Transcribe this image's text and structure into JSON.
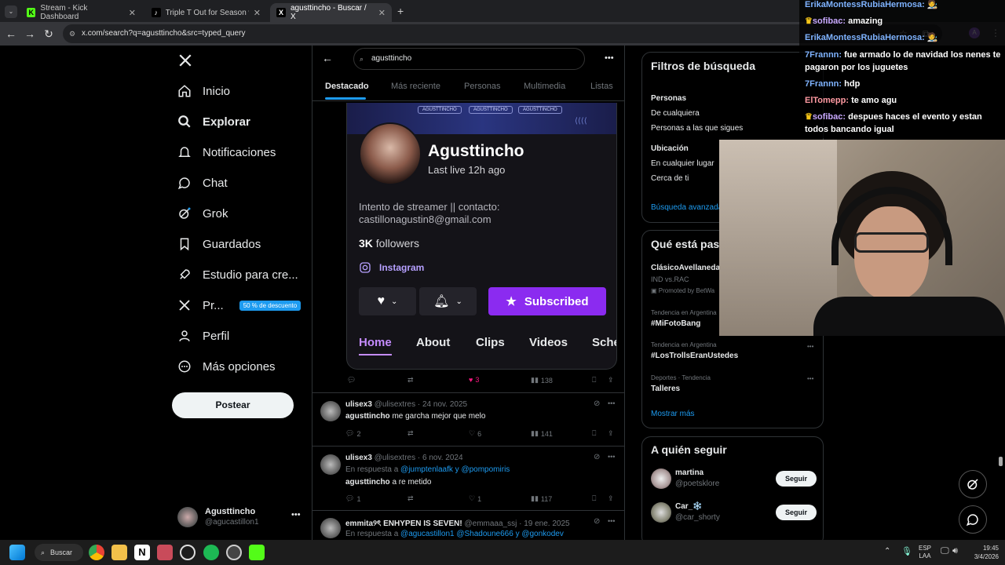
{
  "browser": {
    "tabs": [
      {
        "title": "Stream - Kick Dashboard",
        "favicon": "K"
      },
      {
        "title": "Triple T Out for Season with AC",
        "favicon": "♪"
      },
      {
        "title": "agusttincho - Buscar / X",
        "favicon": "X"
      }
    ],
    "url": "x.com/search?q=agusttincho&src=typed_query"
  },
  "nav": {
    "items": [
      {
        "label": "Inicio",
        "icon": "home-icon"
      },
      {
        "label": "Explorar",
        "icon": "search-icon"
      },
      {
        "label": "Notificaciones",
        "icon": "bell-icon"
      },
      {
        "label": "Chat",
        "icon": "chat-icon"
      },
      {
        "label": "Grok",
        "icon": "grok-icon"
      },
      {
        "label": "Guardados",
        "icon": "bookmark-icon"
      },
      {
        "label": "Estudio para cre...",
        "icon": "rocket-icon"
      },
      {
        "label": "Pr...",
        "icon": "x-logo-icon",
        "badge": "50 % de descuento"
      },
      {
        "label": "Perfil",
        "icon": "person-icon"
      },
      {
        "label": "Más opciones",
        "icon": "more-icon"
      }
    ],
    "post_label": "Postear",
    "account": {
      "name": "Agusttincho",
      "handle": "@agucastillon1"
    }
  },
  "search": {
    "query": "agusttincho",
    "tabs": [
      "Destacado",
      "Más reciente",
      "Personas",
      "Multimedia",
      "Listas"
    ]
  },
  "kick_card": {
    "streamer": "Agusttincho",
    "last_live": "Last live 12h ago",
    "bio_line1": "Intento de streamer || contacto:",
    "bio_line2": "castillonagustin8@gmail.com",
    "followers_count": "3K",
    "followers_label": "followers",
    "instagram": "Instagram",
    "subscribed_label": "Subscribed",
    "tabs": [
      "Home",
      "About",
      "Clips",
      "Videos",
      "Sche"
    ],
    "banner_labels": [
      "AGUSTTINCHO",
      "AGUSTTINCHO",
      "AGUSTTINCHO"
    ],
    "likes": "3",
    "views": "138"
  },
  "tweets": [
    {
      "name": "ulisex3",
      "meta": "@ulisextres · 24 nov. 2025",
      "reply_to": "",
      "body_bold": "agusttincho",
      "body": " me garcha mejor que melo",
      "replies": "2",
      "likes": "6",
      "views": "141"
    },
    {
      "name": "ulisex3",
      "meta": "@ulisextres · 6 nov. 2024",
      "reply_prefix": "En respuesta a",
      "reply_to": "@jumptenlaafk y @pompomiris",
      "body_bold": "agusttincho",
      "body": " a re metido",
      "replies": "1",
      "likes": "1",
      "views": "117"
    },
    {
      "name": "emmita୨ৎ ENHYPEN IS SEVEN!",
      "meta": "@emmaaa_ssj · 19 ene. 2025",
      "reply_prefix": "En respuesta a",
      "reply_to": "@agucastillon1 @Shadoune666 y @gonkodev"
    }
  ],
  "filters": {
    "title": "Filtros de búsqueda",
    "people_heading": "Personas",
    "people_options": [
      "De cualquiera",
      "Personas a las que sigues"
    ],
    "location_heading": "Ubicación",
    "location_options": [
      "En cualquier lugar",
      "Cerca de ti"
    ],
    "advanced": "Búsqueda avanzada"
  },
  "trends": {
    "title": "Qué está pasa",
    "items": [
      {
        "category": "",
        "name": "ClásicoAvellaneda",
        "sub": "IND vs.RAC",
        "promo": "Promoted by BetWa"
      },
      {
        "category": "Tendencia en Argentina",
        "name": "#MiFotoBang"
      },
      {
        "category": "Tendencia en Argentina",
        "name": "#LosTrollsEranUstedes"
      },
      {
        "category": "Deportes · Tendencia",
        "name": "Talleres"
      }
    ],
    "show_more": "Mostrar más"
  },
  "who_to_follow": {
    "title": "A quién seguir",
    "users": [
      {
        "name": "martina",
        "handle": "@poetsklore"
      },
      {
        "name": "Car_❄️",
        "handle": "@car_shorty"
      }
    ],
    "follow_label": "Seguir"
  },
  "chat": [
    {
      "user": "ErikaMontessRubiaHermosa:",
      "msg": "",
      "color": "blue"
    },
    {
      "user": "sofibac:",
      "msg": "amazing",
      "color": "purple"
    },
    {
      "user": "ErikaMontessRubiaHermosa:",
      "msg": "",
      "color": "blue"
    },
    {
      "user": "7Frannn:",
      "msg": "fue armado lo de navidad los nenes te pagaron por los juguetes",
      "color": "blue"
    },
    {
      "user": "7Frannn:",
      "msg": "hdp",
      "color": "blue"
    },
    {
      "user": "ElTomepp:",
      "msg": "te amo agu",
      "color": "purple"
    },
    {
      "user": "sofibac:",
      "msg": "despues haces el evento y estan todos bancando igual",
      "color": "purple"
    }
  ],
  "taskbar": {
    "search_label": "Buscar",
    "lang": "ESP",
    "lang2": "LAA",
    "time": "19:45",
    "date": "3/4/2026"
  }
}
